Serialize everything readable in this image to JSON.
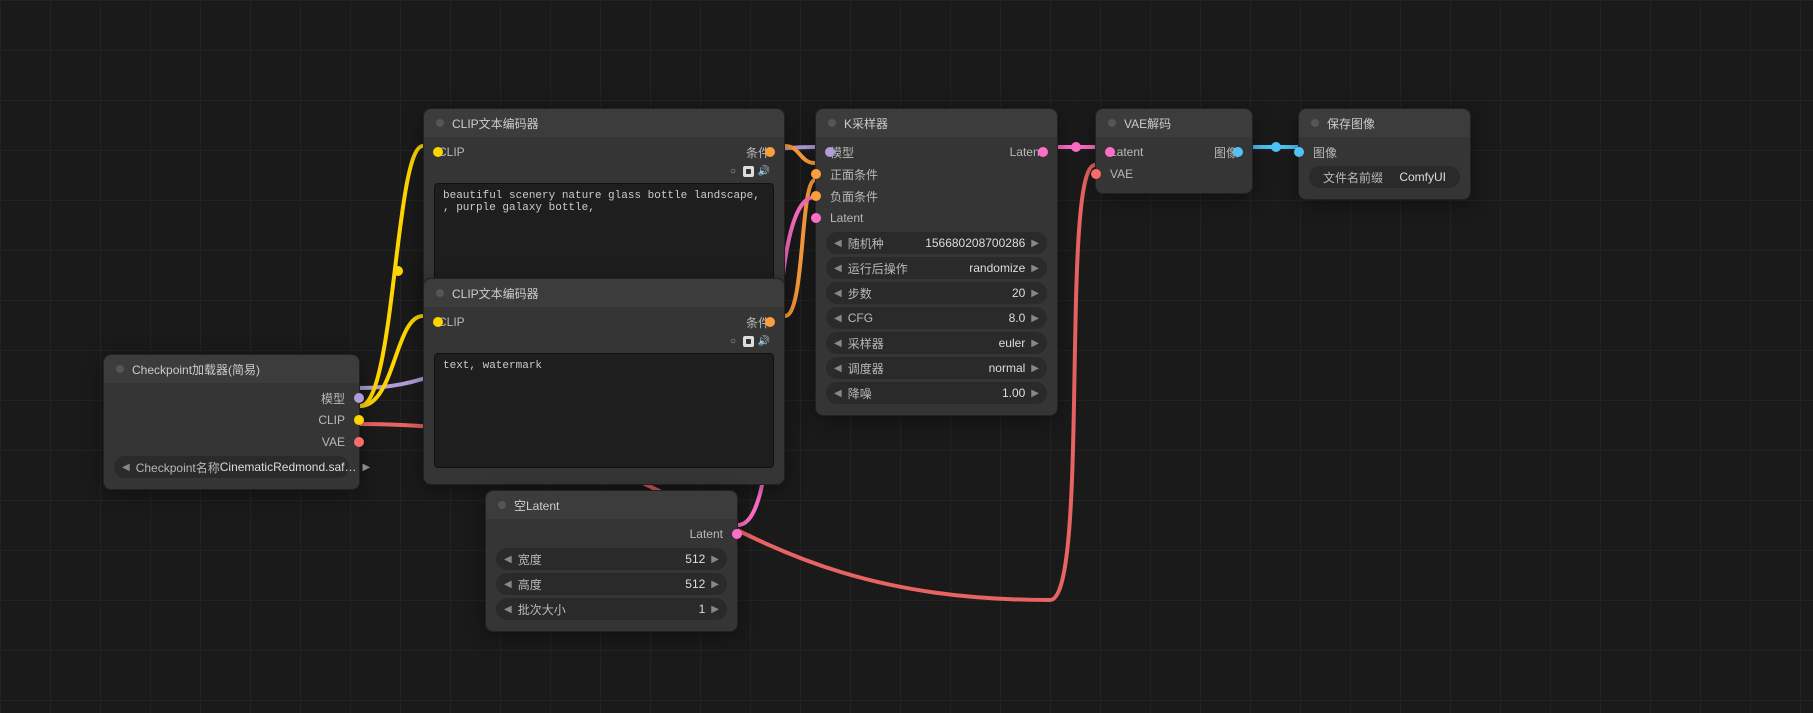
{
  "colors": {
    "model": "#b19cd9",
    "clip": "#ffd500",
    "vae": "#ff6b6b",
    "conditioning": "#ff9e3d",
    "latent": "#ff6ec7",
    "image": "#4fc3f7"
  },
  "nodes": {
    "checkpoint": {
      "title": "Checkpoint加载器(简易)",
      "outputs": {
        "model": "模型",
        "clip": "CLIP",
        "vae": "VAE"
      },
      "widget": {
        "label": "Checkpoint名称",
        "value": "CinematicRedmond.saf…"
      }
    },
    "clip_pos": {
      "title": "CLIP文本编码器",
      "inputs": {
        "clip": "CLIP"
      },
      "outputs": {
        "conditioning": "条件"
      },
      "text": "beautiful scenery nature glass bottle landscape, , purple galaxy bottle,"
    },
    "clip_neg": {
      "title": "CLIP文本编码器",
      "inputs": {
        "clip": "CLIP"
      },
      "outputs": {
        "conditioning": "条件"
      },
      "text": "text, watermark"
    },
    "empty_latent": {
      "title": "空Latent",
      "outputs": {
        "latent": "Latent"
      },
      "widgets": [
        {
          "label": "宽度",
          "value": "512"
        },
        {
          "label": "高度",
          "value": "512"
        },
        {
          "label": "批次大小",
          "value": "1"
        }
      ]
    },
    "ksampler": {
      "title": "K采样器",
      "inputs": {
        "model": "模型",
        "positive": "正面条件",
        "negative": "负面条件",
        "latent": "Latent"
      },
      "outputs": {
        "latent": "Latent"
      },
      "widgets": [
        {
          "label": "随机种",
          "value": "156680208700286"
        },
        {
          "label": "运行后操作",
          "value": "randomize"
        },
        {
          "label": "步数",
          "value": "20"
        },
        {
          "label": "CFG",
          "value": "8.0"
        },
        {
          "label": "采样器",
          "value": "euler"
        },
        {
          "label": "调度器",
          "value": "normal"
        },
        {
          "label": "降噪",
          "value": "1.00"
        }
      ]
    },
    "vae_decode": {
      "title": "VAE解码",
      "inputs": {
        "latent": "Latent",
        "vae": "VAE"
      },
      "outputs": {
        "image": "图像"
      }
    },
    "save_image": {
      "title": "保存图像",
      "inputs": {
        "image": "图像"
      },
      "widget": {
        "label": "文件名前缀",
        "value": "ComfyUI"
      }
    }
  }
}
